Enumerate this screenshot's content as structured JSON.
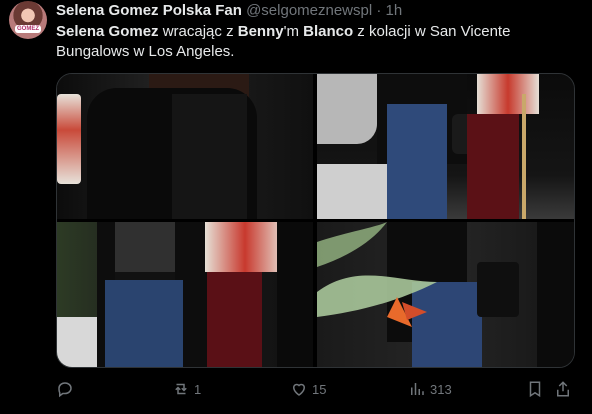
{
  "tweet": {
    "author_name": "Selena Gomez Polska Fan",
    "handle": "@selgomeznewspl",
    "separator": "·",
    "time": "1h",
    "text_parts": {
      "p1": "Selena Gomez",
      "p2": " wracając z ",
      "p3": "Benny",
      "p4": "'m ",
      "p5": "Blanco",
      "p6": " z kolacji w San Vicente Bungalows w Los Angeles."
    },
    "avatar_badge": "GOMEZ"
  },
  "actions": {
    "reply": {
      "icon": "reply-icon",
      "count": ""
    },
    "retweet": {
      "icon": "retweet-icon",
      "count": "1"
    },
    "like": {
      "icon": "heart-icon",
      "count": "15"
    },
    "views": {
      "icon": "views-icon",
      "count": "313"
    },
    "bookmark": {
      "icon": "bookmark-icon"
    },
    "share": {
      "icon": "share-icon"
    }
  },
  "colors": {
    "background": "#000000",
    "text": "#e7e9ea",
    "muted": "#71767b",
    "border": "#2f3336"
  }
}
